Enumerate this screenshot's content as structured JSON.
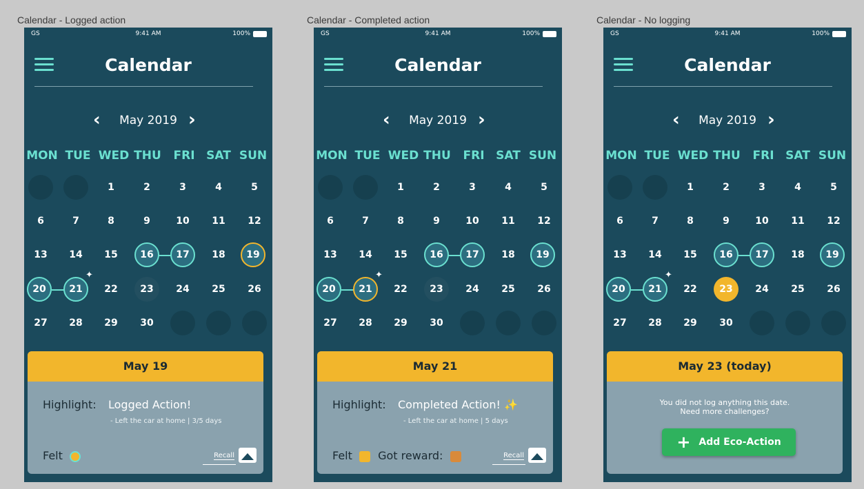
{
  "frames": [
    {
      "label": "Calendar - Logged action",
      "status": {
        "carrier": "GS",
        "time": "9:41 AM",
        "battery": "100%"
      },
      "title": "Calendar",
      "month": "May 2019",
      "weekdays": [
        "MON",
        "TUE",
        "WED",
        "THU",
        "FRI",
        "SAT",
        "SUN"
      ],
      "card": {
        "header": "May 19",
        "highlight_label": "Highlight:",
        "highlight": "Logged Action!",
        "sub": "- Left the car at home | 3/5 days",
        "felt": "Felt",
        "recall": "Recall"
      }
    },
    {
      "label": "Calendar - Completed action",
      "status": {
        "carrier": "GS",
        "time": "9:41 AM",
        "battery": "100%"
      },
      "title": "Calendar",
      "month": "May 2019",
      "weekdays": [
        "MON",
        "TUE",
        "WED",
        "THU",
        "FRI",
        "SAT",
        "SUN"
      ],
      "card": {
        "header": "May 21",
        "highlight_label": "Highlight:",
        "highlight": "Completed Action! ✨",
        "sub": "- Left the car at home | 5 days",
        "felt": "Felt",
        "reward": "Got reward:",
        "recall": "Recall"
      }
    },
    {
      "label": "Calendar - No logging",
      "status": {
        "carrier": "GS",
        "time": "9:41 AM",
        "battery": "100%"
      },
      "title": "Calendar",
      "month": "May 2019",
      "weekdays": [
        "MON",
        "TUE",
        "WED",
        "THU",
        "FRI",
        "SAT",
        "SUN"
      ],
      "card": {
        "header": "May 23 (today)",
        "line1": "You did not log anything this date.",
        "line2": "Need more challenges?",
        "button": "Add Eco-Action"
      }
    }
  ],
  "colors": {
    "background": "#1b4a5c",
    "accent": "#6be0d0",
    "highlight": "#f2b62c",
    "button": "#2fb25e"
  },
  "days": {
    "row1": [
      "1",
      "2",
      "3",
      "4",
      "5"
    ],
    "row2": [
      "6",
      "7",
      "8",
      "9",
      "10",
      "11",
      "12"
    ],
    "row3": [
      "13",
      "14",
      "15",
      "16",
      "17",
      "18",
      "19"
    ],
    "row4": [
      "20",
      "21",
      "22",
      "23",
      "24",
      "25",
      "26"
    ],
    "row5": [
      "27",
      "28",
      "29",
      "30"
    ]
  }
}
